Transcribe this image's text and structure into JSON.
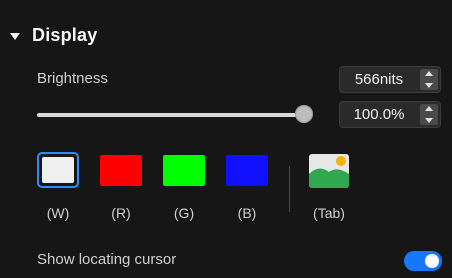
{
  "section": {
    "title": "Display"
  },
  "brightness": {
    "label": "Brightness",
    "nits_value": "566nits",
    "percent_value": "100.0%",
    "slider_level": 1.0
  },
  "colors": {
    "swatches": [
      {
        "label": "(W)",
        "color": "#f0f0f0",
        "selected": true
      },
      {
        "label": "(R)",
        "color": "#ff0000",
        "selected": false
      },
      {
        "label": "(G)",
        "color": "#00ff00",
        "selected": false
      },
      {
        "label": "(B)",
        "color": "#1010ff",
        "selected": false
      }
    ],
    "tab_label": "(Tab)",
    "tab_icon": "image-icon"
  },
  "locating_cursor": {
    "label": "Show locating cursor",
    "enabled": true
  },
  "accent_color": "#1677ff"
}
